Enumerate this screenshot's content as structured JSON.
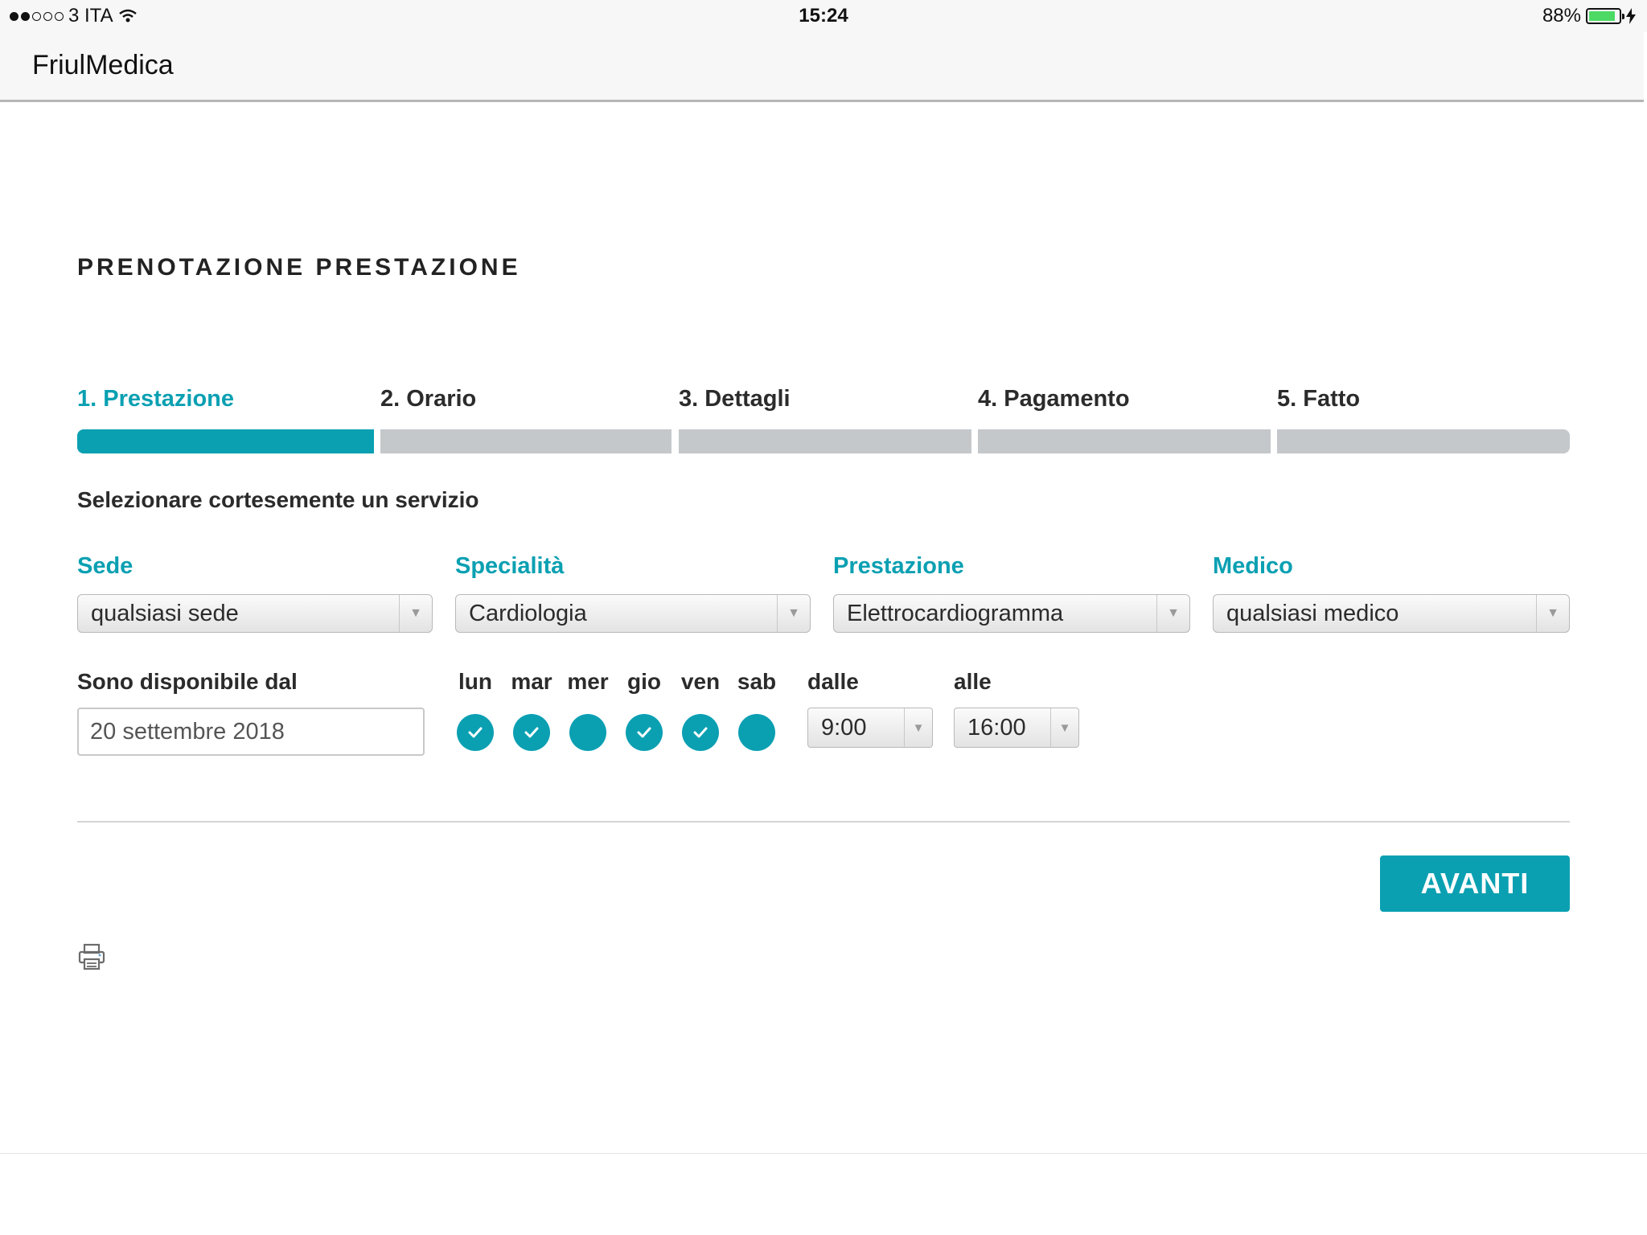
{
  "status_bar": {
    "carrier": "3 ITA",
    "time": "15:24",
    "battery_text": "88%",
    "battery_level": 0.88,
    "signal_bars_filled": 2,
    "signal_bars_total": 5
  },
  "app": {
    "title": "FriulMedica"
  },
  "page": {
    "title": "PRENOTAZIONE PRESTAZIONE"
  },
  "steps": [
    {
      "label": "1. Prestazione",
      "active": true
    },
    {
      "label": "2. Orario",
      "active": false
    },
    {
      "label": "3. Dettagli",
      "active": false
    },
    {
      "label": "4. Pagamento",
      "active": false
    },
    {
      "label": "5. Fatto",
      "active": false
    }
  ],
  "instruction": "Selezionare cortesemente un servizio",
  "filters": {
    "sede": {
      "label": "Sede",
      "value": "qualsiasi sede"
    },
    "specialita": {
      "label": "Specialità",
      "value": "Cardiologia"
    },
    "prestazione": {
      "label": "Prestazione",
      "value": "Elettrocardiogramma"
    },
    "medico": {
      "label": "Medico",
      "value": "qualsiasi medico"
    }
  },
  "availability": {
    "label": "Sono disponibile dal",
    "date": "20 settembre 2018",
    "days": [
      {
        "label": "lun",
        "checked": true
      },
      {
        "label": "mar",
        "checked": true
      },
      {
        "label": "mer",
        "checked": false
      },
      {
        "label": "gio",
        "checked": true
      },
      {
        "label": "ven",
        "checked": true
      },
      {
        "label": "sab",
        "checked": false
      }
    ],
    "from_label": "dalle",
    "from_value": "9:00",
    "to_label": "alle",
    "to_value": "16:00"
  },
  "actions": {
    "next_label": "AVANTI"
  },
  "icons": {
    "print": "printer-icon",
    "wifi": "wifi-icon",
    "charging": "bolt-icon"
  },
  "colors": {
    "accent": "#0aa0b2",
    "inactive_step": "#c4c8cb",
    "battery": "#4cd964"
  }
}
